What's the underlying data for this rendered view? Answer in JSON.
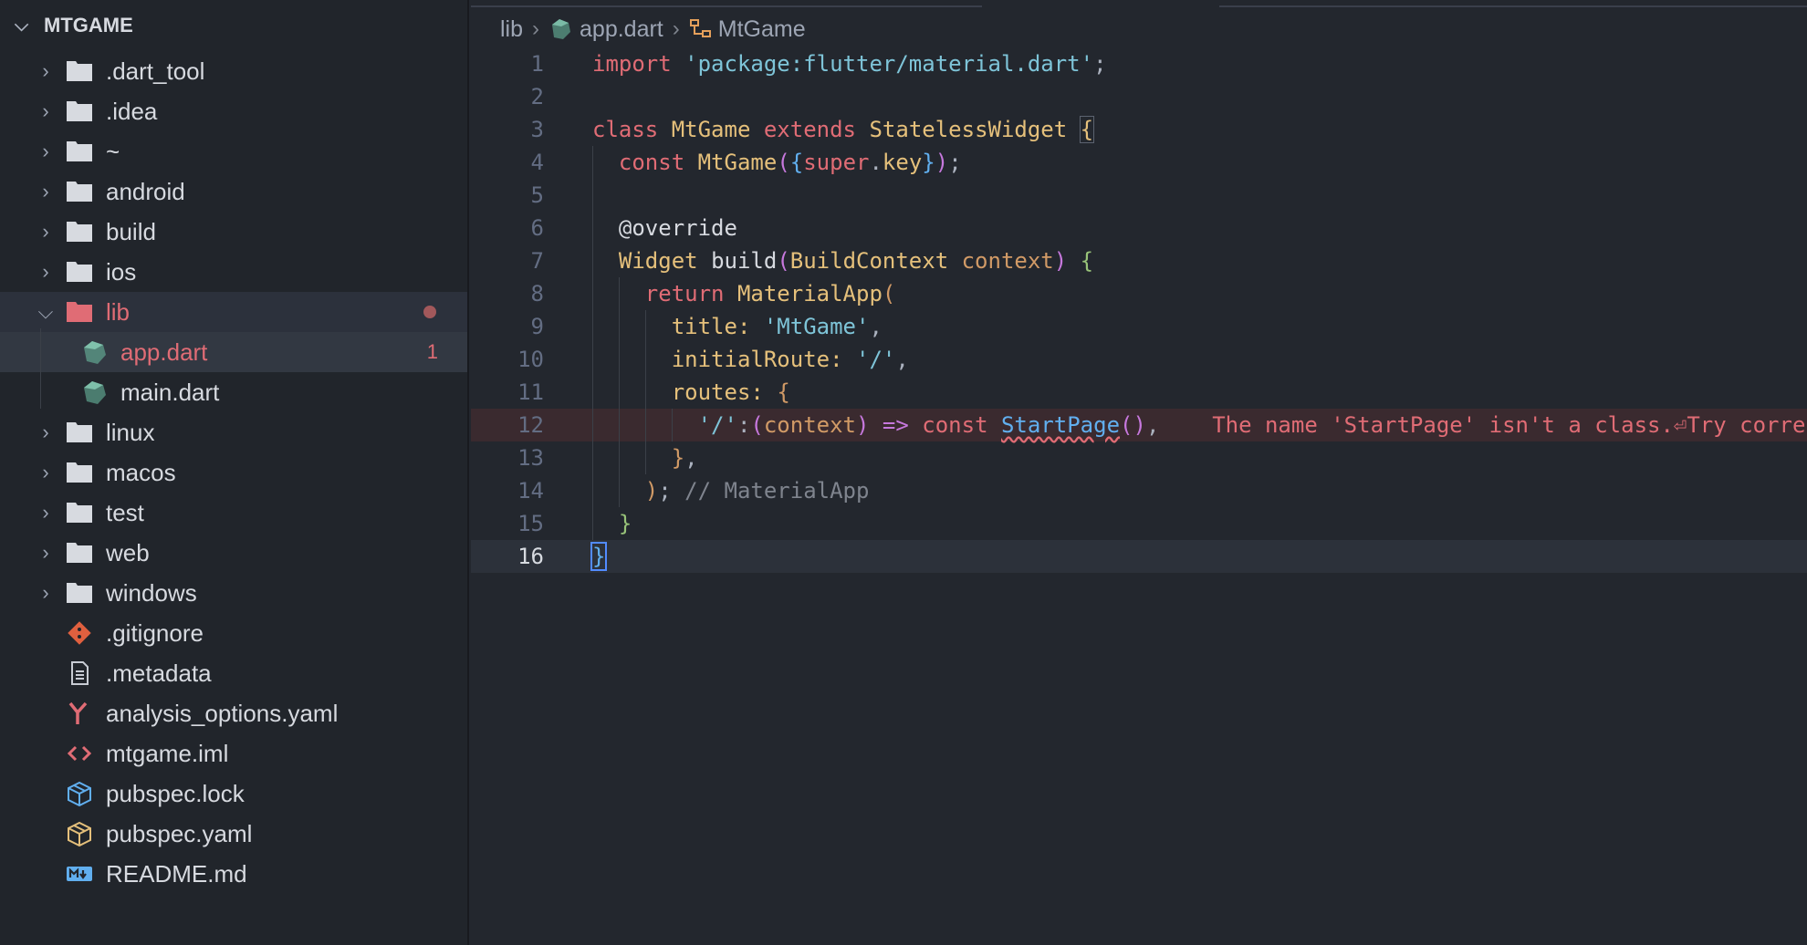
{
  "explorer": {
    "root_label": "MTGAME",
    "items": [
      {
        "label": ".dart_tool",
        "type": "folder",
        "icon": "folder-icon"
      },
      {
        "label": ".idea",
        "type": "folder",
        "icon": "folder-icon"
      },
      {
        "label": "~",
        "type": "folder",
        "icon": "folder-icon"
      },
      {
        "label": "android",
        "type": "folder",
        "icon": "folder-icon"
      },
      {
        "label": "build",
        "type": "folder",
        "icon": "folder-icon"
      },
      {
        "label": "ios",
        "type": "folder",
        "icon": "folder-icon"
      },
      {
        "label": "lib",
        "type": "folder-open",
        "icon": "folder-open-icon",
        "badge": "dot"
      },
      {
        "label": "app.dart",
        "type": "file",
        "icon": "dart-icon",
        "badge": "1"
      },
      {
        "label": "main.dart",
        "type": "file",
        "icon": "dart-icon"
      },
      {
        "label": "linux",
        "type": "folder",
        "icon": "folder-icon"
      },
      {
        "label": "macos",
        "type": "folder",
        "icon": "folder-icon"
      },
      {
        "label": "test",
        "type": "folder",
        "icon": "folder-icon"
      },
      {
        "label": "web",
        "type": "folder",
        "icon": "folder-icon"
      },
      {
        "label": "windows",
        "type": "folder",
        "icon": "folder-icon"
      },
      {
        "label": ".gitignore",
        "type": "file",
        "icon": "git-icon"
      },
      {
        "label": ".metadata",
        "type": "file",
        "icon": "document-icon"
      },
      {
        "label": "analysis_options.yaml",
        "type": "file",
        "icon": "yaml-icon"
      },
      {
        "label": "mtgame.iml",
        "type": "file",
        "icon": "code-icon"
      },
      {
        "label": "pubspec.lock",
        "type": "file",
        "icon": "package-icon"
      },
      {
        "label": "pubspec.yaml",
        "type": "file",
        "icon": "package-icon"
      },
      {
        "label": "README.md",
        "type": "file",
        "icon": "markdown-icon"
      }
    ]
  },
  "breadcrumb": {
    "folder": "lib",
    "file": "app.dart",
    "symbol": "MtGame"
  },
  "editor": {
    "line_numbers": [
      "1",
      "2",
      "3",
      "4",
      "5",
      "6",
      "7",
      "8",
      "9",
      "10",
      "11",
      "12",
      "13",
      "14",
      "15",
      "16"
    ],
    "current_line": "16",
    "error_message": "The name 'StartPage' isn't a class.⏎Try corre"
  },
  "colors": {
    "background": "#23272e",
    "sidebar": "#21252b",
    "error": "#e06c75",
    "folder": "#d7dae0",
    "folder_open": "#e06c75",
    "dart": "#6fc4a8"
  }
}
